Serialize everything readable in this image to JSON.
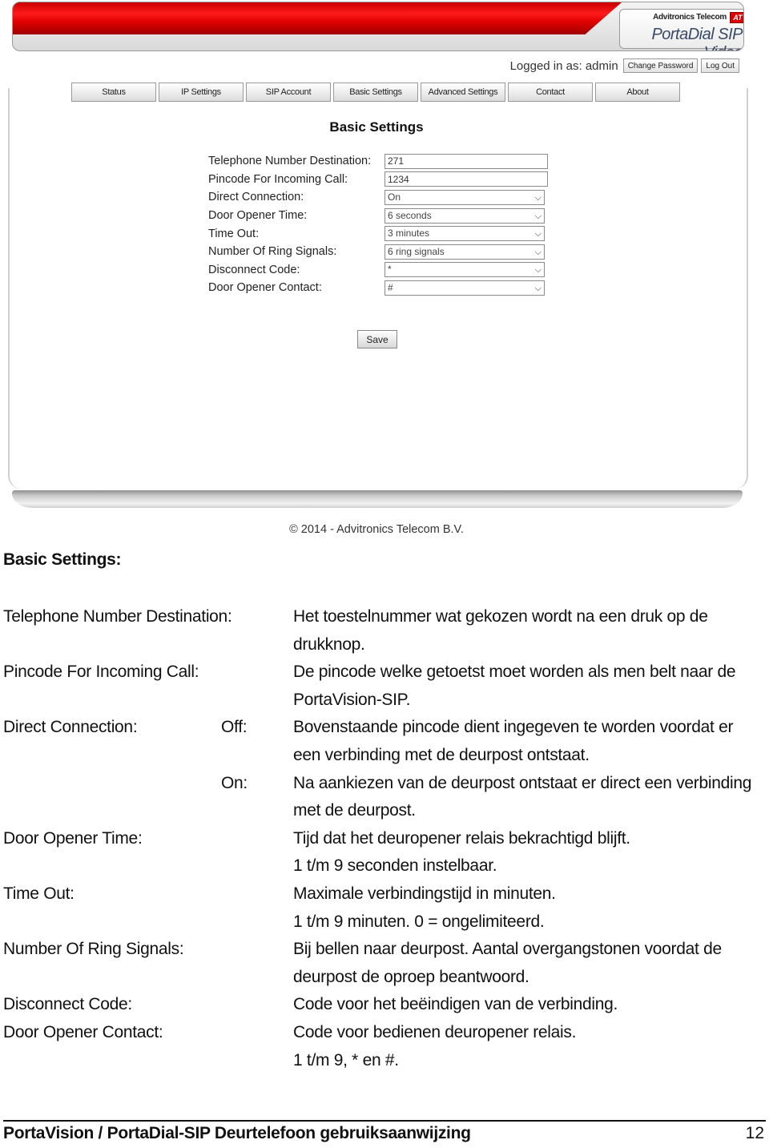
{
  "header": {
    "company": "Advitronics Telecom",
    "company_badge": "AT",
    "product": "PortaDial SIP Video",
    "brand_color": "#e00000"
  },
  "session": {
    "logged_in_text": "Logged in as: admin",
    "change_password_label": "Change Password",
    "logout_label": "Log Out"
  },
  "nav": {
    "tabs": [
      {
        "label": "Status"
      },
      {
        "label": "IP Settings"
      },
      {
        "label": "SIP Account"
      },
      {
        "label": "Basic Settings"
      },
      {
        "label": "Advanced Settings"
      },
      {
        "label": "Contact"
      },
      {
        "label": "About"
      }
    ]
  },
  "form": {
    "title": "Basic Settings",
    "fields": [
      {
        "label": "Telephone Number Destination:",
        "type": "text",
        "value": "271"
      },
      {
        "label": "Pincode For Incoming Call:",
        "type": "text",
        "value": "1234"
      },
      {
        "label": "Direct Connection:",
        "type": "select",
        "value": "On"
      },
      {
        "label": "Door Opener Time:",
        "type": "select",
        "value": "6 seconds"
      },
      {
        "label": "Time Out:",
        "type": "select",
        "value": "3 minutes"
      },
      {
        "label": "Number Of Ring Signals:",
        "type": "select",
        "value": "6 ring signals"
      },
      {
        "label": "Disconnect Code:",
        "type": "select",
        "value": "*"
      },
      {
        "label": "Door Opener Contact:",
        "type": "select",
        "value": "#"
      }
    ],
    "save_label": "Save"
  },
  "site_footer": {
    "copyright": "© 2014 - Advitronics Telecom B.V."
  },
  "document": {
    "heading": "Basic Settings:",
    "lines": [
      {
        "term": "Telephone Number Destination:",
        "option": "",
        "text": "Het toestelnummer wat gekozen wordt na een druk op de"
      },
      {
        "term": "",
        "option": "",
        "text": "drukknop."
      },
      {
        "term": "Pincode For Incoming Call:",
        "option": "",
        "text": "De pincode welke getoetst moet worden als men belt naar de"
      },
      {
        "term": "",
        "option": "",
        "text": "PortaVision-SIP."
      },
      {
        "term": "Direct Connection:",
        "option": "Off:",
        "text": "Bovenstaande pincode dient ingegeven te worden voordat er"
      },
      {
        "term": "",
        "option": "",
        "text": "een verbinding met de deurpost ontstaat."
      },
      {
        "term": "",
        "option": "On:",
        "text": "Na aankiezen van de deurpost ontstaat er direct een verbinding"
      },
      {
        "term": "",
        "option": "",
        "text": "met de deurpost."
      },
      {
        "term": "Door Opener Time:",
        "option": "",
        "text": "Tijd dat het deuropener relais bekrachtigd blijft."
      },
      {
        "term": "",
        "option": "",
        "text": "1 t/m 9 seconden instelbaar."
      },
      {
        "term": "Time Out:",
        "option": "",
        "text": "Maximale verbindingstijd in minuten."
      },
      {
        "term": "",
        "option": "",
        "text": "1 t/m 9 minuten. 0 = ongelimiteerd."
      },
      {
        "term": "Number Of Ring Signals:",
        "option": "",
        "text": "Bij bellen naar deurpost. Aantal overgangstonen voordat de"
      },
      {
        "term": "",
        "option": "",
        "text": "deurpost de oproep beantwoord."
      },
      {
        "term": "Disconnect Code:",
        "option": "",
        "text": "Code voor het beëindigen van de verbinding."
      },
      {
        "term": "Door Opener Contact:",
        "option": "",
        "text": "Code voor bedienen deuropener relais."
      },
      {
        "term": "",
        "option": "",
        "text": "1 t/m 9, * en  #."
      }
    ],
    "footer_title": "PortaVision / PortaDial-SIP Deurtelefoon gebruiksaanwijzing",
    "page_number": "12"
  }
}
